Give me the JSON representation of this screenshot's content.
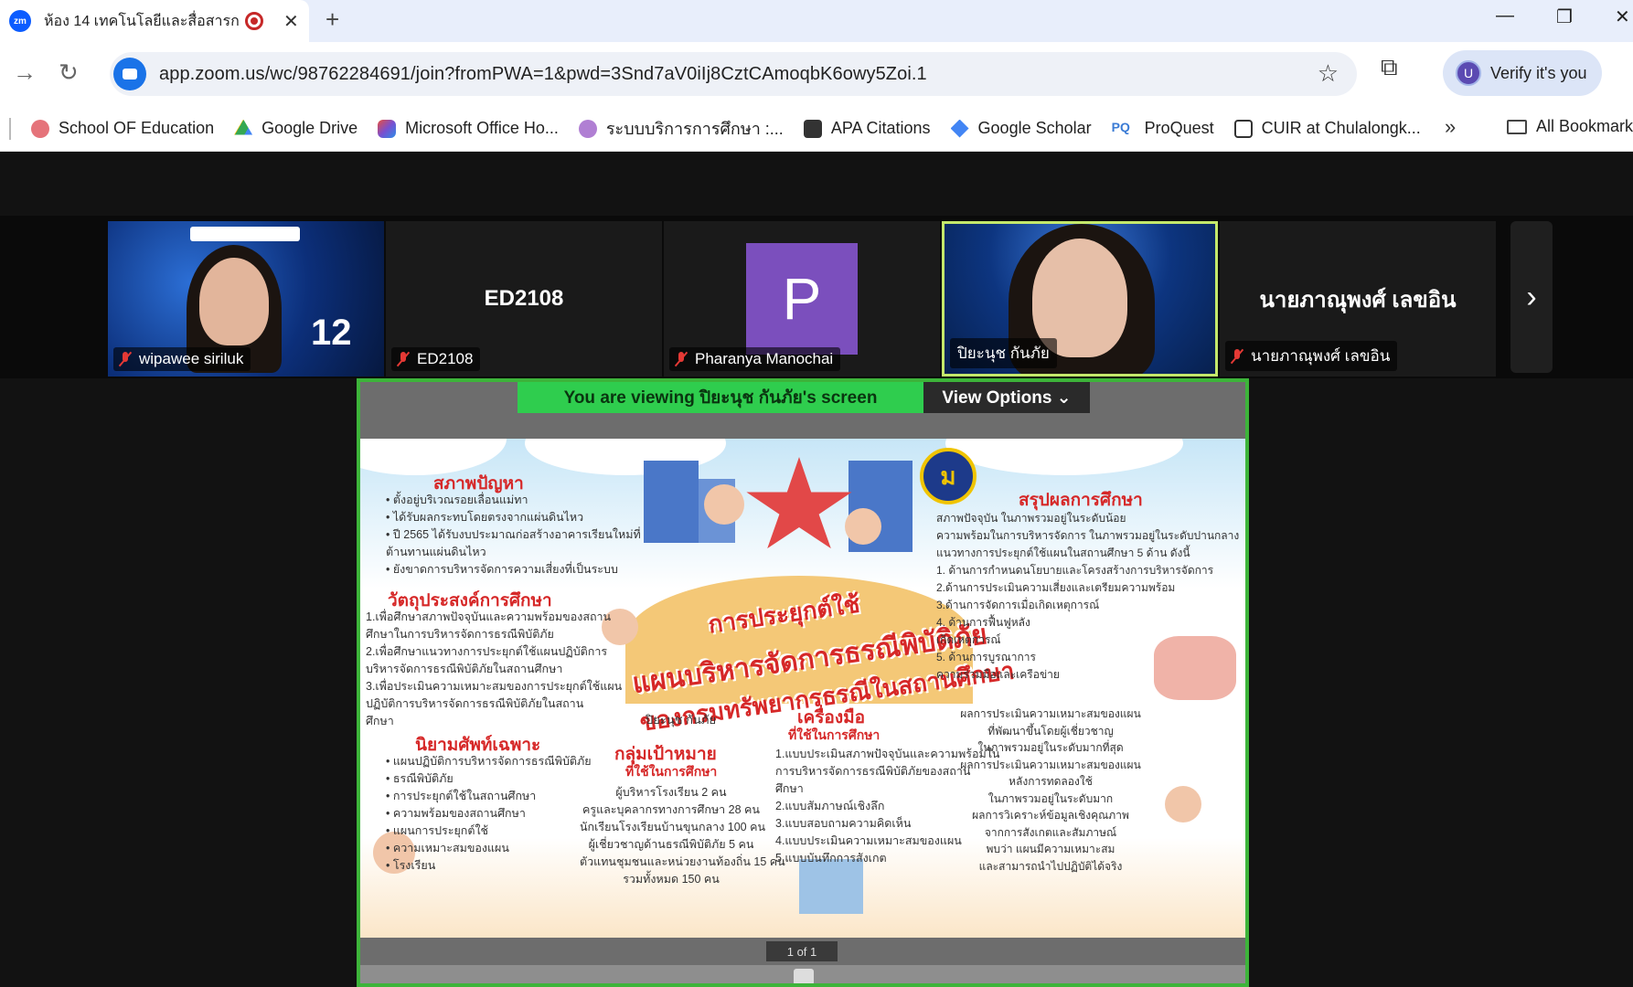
{
  "browser": {
    "tab_title": "ห้อง 14 เทคโนโลยีและสื่อสารการ",
    "tab_favicon": "zm",
    "url": "app.zoom.us/wc/98762284691/join?fromPWA=1&pwd=3Snd7aV0iIj8CztCAmoqbK6owy5Zoi.1",
    "verify_label": "Verify it's you",
    "verify_avatar": "U",
    "bookmarks": [
      "School OF Education",
      "Google Drive",
      "Microsoft Office Ho...",
      "ระบบบริการการศึกษา :...",
      "APA Citations",
      "Google Scholar",
      "ProQuest",
      "CUIR at Chulalongk..."
    ],
    "bookmarks_more": "»",
    "all_bookmarks": "All Bookmarks"
  },
  "zoom": {
    "participants": [
      {
        "name": "wipawee siriluk",
        "center": ""
      },
      {
        "name": "ED2108",
        "center": "ED2108"
      },
      {
        "name": "Pharanya Manochai",
        "center": "P"
      },
      {
        "name": "ปิยะนุช กันภัย",
        "center": ""
      },
      {
        "name": "นายภาณุพงศ์ เลขอิน",
        "center": "นายภาณุพงศ์ เลขอิน"
      }
    ],
    "viewing_label": "You are viewing  ปิยะนุช กันภัย's screen",
    "view_options": "View Options ⌄",
    "page_indicator": "1 of 1"
  },
  "slide": {
    "title_line1": "การประยุกต์ใช้",
    "title_line2": "แผนบริหารจัดการธรณีพิบัติภัย",
    "title_line3": "ของกรมทรัพยากรธรณีในสถานศึกษา",
    "author": "ปิยะนุช กันภัย",
    "problem_heading": "สภาพปัญหา",
    "problem_items": [
      "• ตั้งอยู่บริเวณรอยเลื่อนแม่ทา",
      "• ได้รับผลกระทบโดยตรงจากแผ่นดินไหว",
      "• ปี 2565 ได้รับงบประมาณก่อสร้างอาคารเรียนใหม่ที่",
      "   ต้านทานแผ่นดินไหว",
      "• ยังขาดการบริหารจัดการความเสี่ยงที่เป็นระบบ"
    ],
    "objective_heading": "วัตถุประสงค์การศึกษา",
    "objective_items": [
      "1.เพื่อศึกษาสภาพปัจจุบันและความพร้อมของสถาน",
      "   ศึกษาในการบริหารจัดการธรณีพิบัติภัย",
      "2.เพื่อศึกษาแนวทางการประยุกต์ใช้แผนปฏิบัติการ",
      "   บริหารจัดการธรณีพิบัติภัยในสถานศึกษา",
      "3.เพื่อประเมินความเหมาะสมของการประยุกต์ใช้แผน",
      "   ปฏิบัติการบริหารจัดการธรณีพิบัติภัยในสถาน",
      "   ศึกษา"
    ],
    "terms_heading": "นิยามศัพท์เฉพาะ",
    "terms_items": [
      "• แผนปฏิบัติการบริหารจัดการธรณีพิบัติภัย",
      "• ธรณีพิบัติภัย",
      "• การประยุกต์ใช้ในสถานศึกษา",
      "• ความพร้อมของสถานศึกษา",
      "      • แผนการประยุกต์ใช้",
      "      • ความเหมาะสมของแผน",
      "      • โรงเรียน"
    ],
    "target_heading": "กลุ่มเป้าหมาย",
    "target_sub": "ที่ใช้ในการศึกษา",
    "target_items": [
      "ผู้บริหารโรงเรียน 2 คน",
      "ครูและบุคลากรทางการศึกษา 28 คน",
      "นักเรียนโรงเรียนบ้านขุนกลาง 100 คน",
      "ผู้เชี่ยวชาญด้านธรณีพิบัติภัย 5 คน",
      "ตัวแทนชุมชนและหน่วยงานท้องถิ่น 15 คน",
      "รวมทั้งหมด 150 คน"
    ],
    "tools_heading": "เครื่องมือ",
    "tools_sub": "ที่ใช้ในการศึกษา",
    "tools_items": [
      "1.แบบประเมินสภาพปัจจุบันและความพร้อมใน",
      "   การบริหารจัดการธรณีพิบัติภัยของสถาน",
      "   ศึกษา",
      "2.แบบสัมภาษณ์เชิงลึก",
      "3.แบบสอบถามความคิดเห็น",
      "4.แบบประเมินความเหมาะสมของแผน",
      "5.แบบบันทึกการสังเกต"
    ],
    "summary_heading": "สรุปผลการศึกษา",
    "summary_items": [
      "สภาพปัจจุบัน ในภาพรวมอยู่ในระดับน้อย",
      "ความพร้อมในการบริหารจัดการ ในภาพรวมอยู่ในระดับปานกลาง",
      "แนวทางการประยุกต์ใช้แผนในสถานศึกษา 5 ด้าน ดังนี้",
      "   1. ด้านการกำหนดนโยบายและโครงสร้างการบริหารจัดการ",
      "   2.ด้านการประเมินความเสี่ยงและเตรียมความพร้อม",
      "   3.ด้านการจัดการเมื่อเกิดเหตุการณ์",
      "      4. ด้านการฟื้นฟูหลัง",
      "      เกิดเหตุการณ์",
      "      5. ด้านการบูรณาการ",
      "      ความร่วมมือและเครือข่าย"
    ],
    "result_items": [
      "ผลการประเมินความเหมาะสมของแผน",
      "ที่พัฒนาขึ้นโดยผู้เชี่ยวชาญ",
      "ในภาพรวมอยู่ในระดับมากที่สุด",
      "ผลการประเมินความเหมาะสมของแผน",
      "หลังการทดลองใช้",
      "ในภาพรวมอยู่ในระดับมาก",
      "ผลการวิเคราะห์ข้อมูลเชิงคุณภาพ",
      "จากการสังเกตและสัมภาษณ์",
      "พบว่า แผนมีความเหมาะสม",
      "และสามารถนำไปปฏิบัติได้จริง"
    ]
  }
}
